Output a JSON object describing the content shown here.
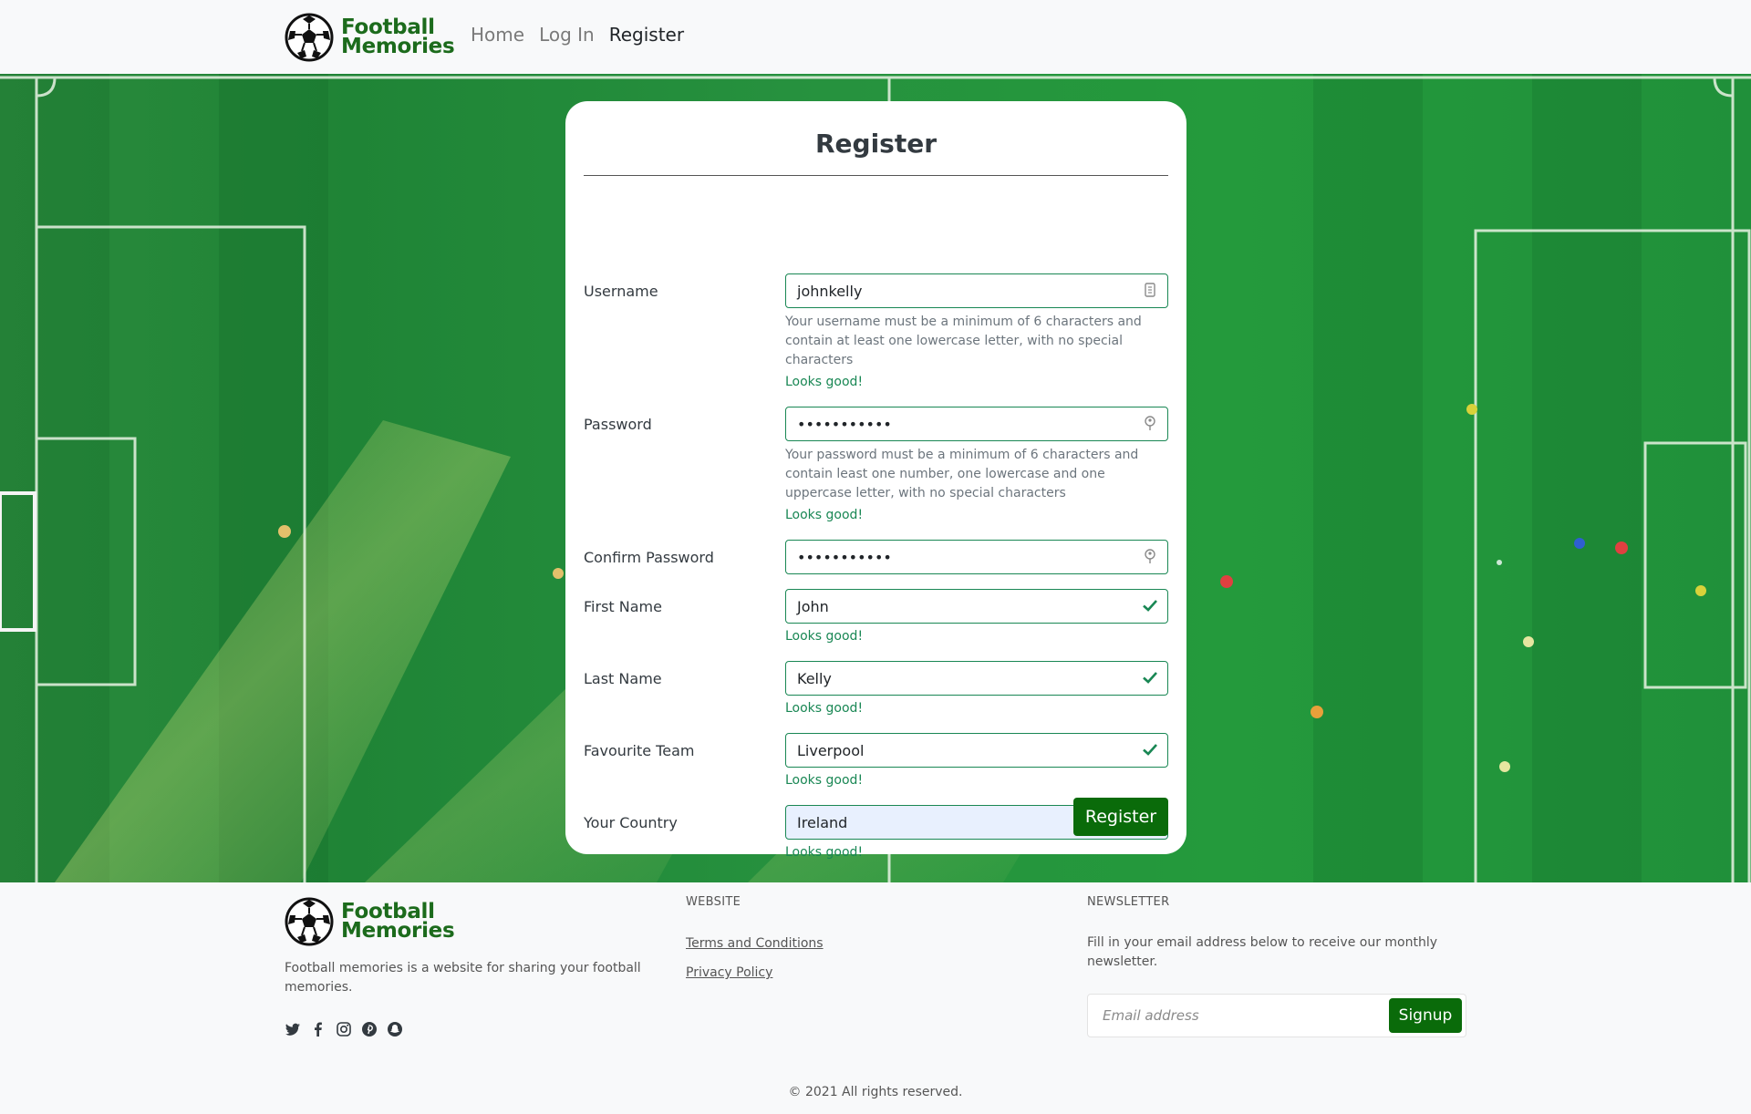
{
  "header": {
    "brand_line1": "Football",
    "brand_line2": "Memories",
    "nav": [
      {
        "label": "Home"
      },
      {
        "label": "Log In"
      },
      {
        "label": "Register"
      }
    ]
  },
  "form": {
    "title": "Register",
    "username": {
      "label": "Username",
      "value": "johnkelly",
      "help": "Your username must be a minimum of 6 characters and contain at least one lowercase letter, with no special characters",
      "feedback": "Looks good!"
    },
    "password": {
      "label": "Password",
      "value": "•••••••••••",
      "help": "Your password must be a minimum of 6 characters and contain least one number, one lowercase and one uppercase letter, with no special characters",
      "feedback": "Looks good!"
    },
    "confirm_password": {
      "label": "Confirm Password",
      "value": "•••••••••••"
    },
    "first_name": {
      "label": "First Name",
      "value": "John",
      "feedback": "Looks good!"
    },
    "last_name": {
      "label": "Last Name",
      "value": "Kelly",
      "feedback": "Looks good!"
    },
    "favourite_team": {
      "label": "Favourite Team",
      "value": "Liverpool",
      "feedback": "Looks good!"
    },
    "country": {
      "label": "Your Country",
      "value": "Ireland",
      "feedback": "Looks good!"
    },
    "submit_label": "Register"
  },
  "footer": {
    "brand_line1": "Football",
    "brand_line2": "Memories",
    "description": "Football memories is a website for sharing your football memories.",
    "social_icons": [
      "twitter-icon",
      "facebook-icon",
      "instagram-icon",
      "pinterest-icon",
      "snapchat-icon"
    ],
    "website_heading": "WEBSITE",
    "links": [
      "Terms and Conditions",
      "Privacy Policy"
    ],
    "newsletter_heading": "NEWSLETTER",
    "newsletter_text": "Fill in your email address below to receive our monthly newsletter.",
    "email_placeholder": "Email address",
    "signup_label": "Signup",
    "copyright": "© 2021 All rights reserved."
  },
  "colors": {
    "brand_green": "#1c6b1c",
    "button_green": "#0a6b0a",
    "valid_green": "#198754"
  }
}
